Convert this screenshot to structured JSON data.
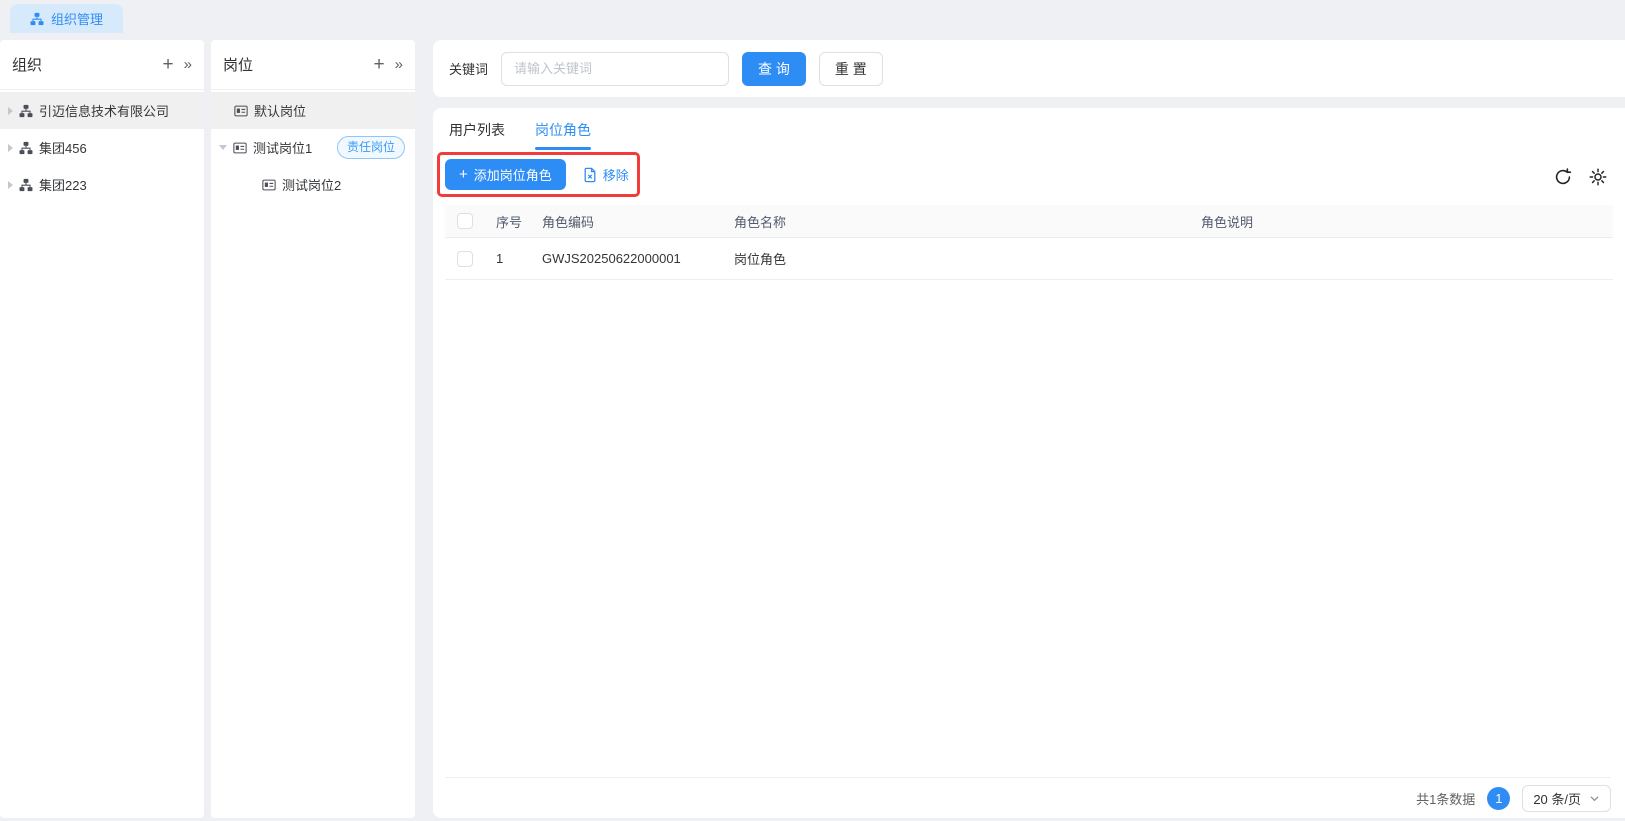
{
  "colors": {
    "primary": "#2e8df5",
    "annotation_red": "#f23c3c",
    "tab_active_bg": "#d7eafc",
    "badge_blue": "#3a9cf5"
  },
  "window_tab": {
    "label": "组织管理"
  },
  "org_panel": {
    "title": "组织",
    "add_icon": "+",
    "collapse_icon": "»",
    "items": [
      {
        "label": "引迈信息技术有限公司"
      },
      {
        "label": "集团456"
      },
      {
        "label": "集团223"
      }
    ]
  },
  "position_panel": {
    "title": "岗位",
    "add_icon": "+",
    "collapse_icon": "»",
    "items": [
      {
        "label": "默认岗位"
      },
      {
        "label": "测试岗位1",
        "badge": "责任岗位"
      },
      {
        "label": "测试岗位2"
      }
    ]
  },
  "search_bar": {
    "label": "关键词",
    "placeholder": "请输入关键词",
    "query_button": "查 询",
    "reset_button": "重 置"
  },
  "content_tabs": {
    "user_list": "用户列表",
    "position_role": "岗位角色"
  },
  "toolbar": {
    "add_plus": "+",
    "add_button": "添加岗位角色",
    "remove_button": "移除"
  },
  "table": {
    "headers": {
      "index": "序号",
      "code": "角色编码",
      "name": "角色名称",
      "description": "角色说明"
    },
    "rows": [
      {
        "index": "1",
        "code": "GWJS20250622000001",
        "name": "岗位角色",
        "description": ""
      }
    ]
  },
  "pagination": {
    "total": "共1条数据",
    "current_page": "1",
    "page_size": "20 条/页"
  }
}
